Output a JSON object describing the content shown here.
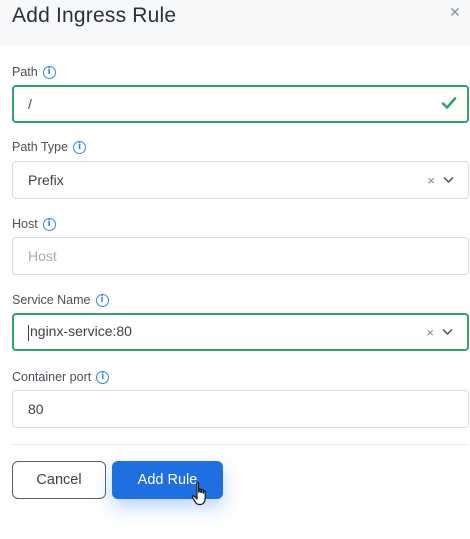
{
  "dialog": {
    "title": "Add Ingress Rule",
    "close_glyph": "✕"
  },
  "fields": {
    "path": {
      "label": "Path",
      "value": "/"
    },
    "path_type": {
      "label": "Path Type",
      "value": "Prefix"
    },
    "host": {
      "label": "Host",
      "value": "",
      "placeholder": "Host"
    },
    "service_name": {
      "label": "Service Name",
      "value": "nginx-service:80"
    },
    "container_port": {
      "label": "Container port",
      "value": "80"
    }
  },
  "buttons": {
    "cancel": "Cancel",
    "add": "Add Rule"
  },
  "icons": {
    "info": "info-icon",
    "check": "check-icon",
    "clear": "clear-icon",
    "chevron": "chevron-down-icon",
    "cursor": "hand-pointer-icon"
  },
  "colors": {
    "primary": "#1f6fe0",
    "valid_border": "#2fa46a",
    "info_blue": "#2f87e8"
  }
}
